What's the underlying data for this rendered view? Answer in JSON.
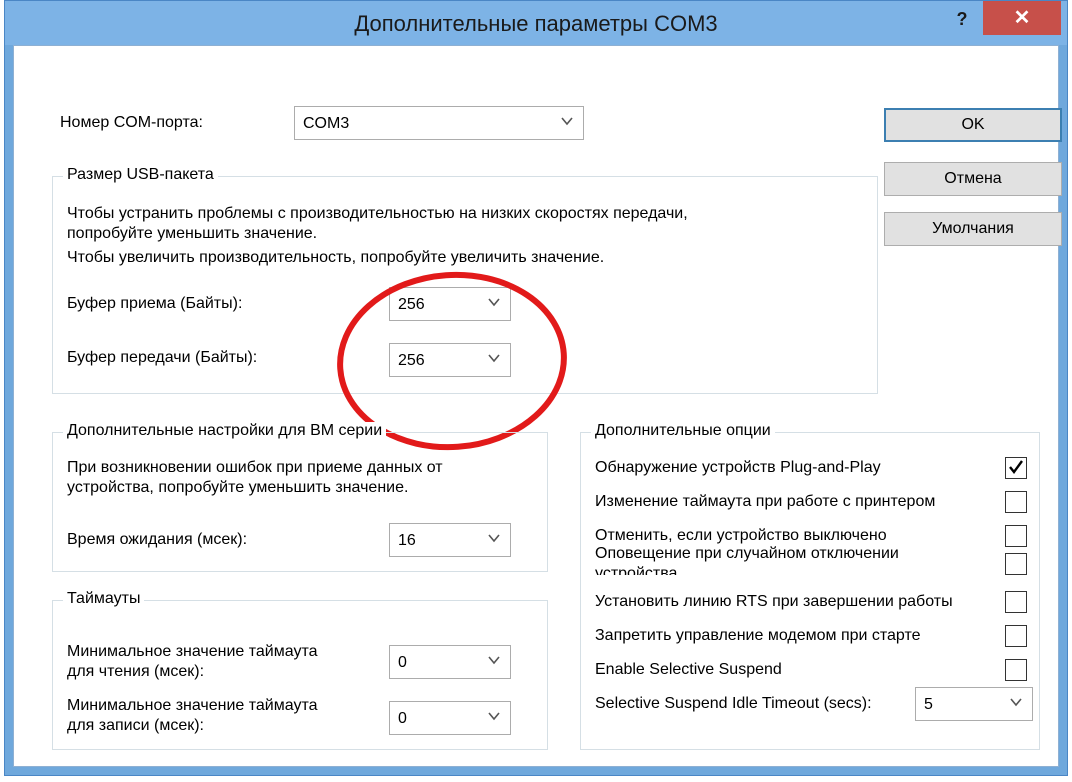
{
  "window": {
    "title": "Дополнительные параметры COM3",
    "help_label": "?",
    "close_label": "✕"
  },
  "port": {
    "label": "Номер COM-порта:",
    "value": "COM3"
  },
  "buttons": {
    "ok": "OK",
    "cancel": "Отмена",
    "defaults": "Умолчания"
  },
  "usb": {
    "title": "Размер USB-пакета",
    "desc1": "Чтобы устранить проблемы с производительностью на низких скоростях передачи,",
    "desc2": "попробуйте уменьшить значение.",
    "desc3": "Чтобы увеличить производительность, попробуйте увеличить значение.",
    "rx_label": "Буфер приема (Байты):",
    "rx_value": "256",
    "tx_label": "Буфер передачи (Байты):",
    "tx_value": "256"
  },
  "bm": {
    "title": "Дополнительные настройки для BM серии",
    "desc1": "При возникновении ошибок при приеме данных от",
    "desc2": "устройства, попробуйте уменьшить значение.",
    "latency_label": "Время ожидания (мсек):",
    "latency_value": "16"
  },
  "timeouts": {
    "title": "Таймауты",
    "read_label1": "Минимальное значение таймаута",
    "read_label2": "для чтения (мсек):",
    "read_value": "0",
    "write_label1": "Минимальное значение таймаута",
    "write_label2": "для записи (мсек):",
    "write_value": "0"
  },
  "options": {
    "title": "Дополнительные опции",
    "items": [
      {
        "label": "Обнаружение устройств Plug-and-Play",
        "checked": true
      },
      {
        "label": "Изменение таймаута при работе с принтером",
        "checked": false
      },
      {
        "label": "Отменить, если устройство выключено",
        "checked": false
      },
      {
        "label": "Оповещение при случайном отключении",
        "label2": "устройства",
        "checked": false
      },
      {
        "label": "Установить линию RTS при завершении работы",
        "checked": false
      },
      {
        "label": "Запретить управление модемом при старте",
        "checked": false
      },
      {
        "label": "Enable Selective Suspend",
        "checked": false
      }
    ],
    "idle_label": "Selective Suspend Idle Timeout (secs):",
    "idle_value": "5"
  },
  "colors": {
    "annotation": "#e21a1a",
    "titlebar": "#7db3e6",
    "close": "#c7504a"
  }
}
